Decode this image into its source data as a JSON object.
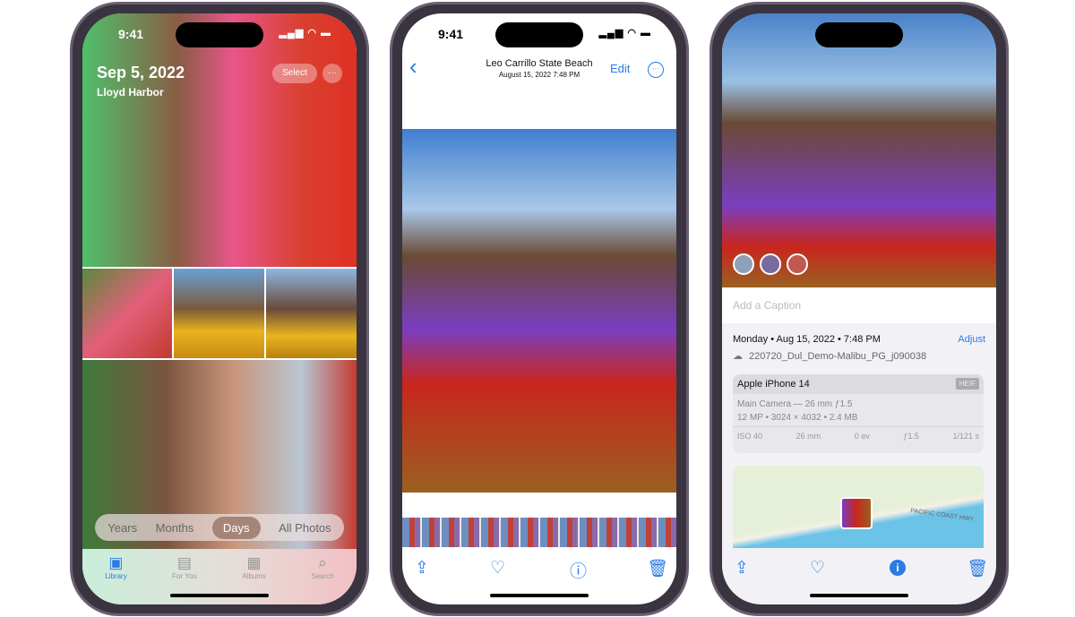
{
  "status_time": "9:41",
  "phone1": {
    "date": "Sep 5, 2022",
    "location": "Lloyd Harbor",
    "select_label": "Select",
    "more_label": "···",
    "segments": [
      {
        "label": "Years"
      },
      {
        "label": "Months"
      },
      {
        "label": "Days",
        "selected": true
      },
      {
        "label": "All Photos"
      }
    ],
    "tabs": [
      {
        "label": "Library",
        "active": true
      },
      {
        "label": "For You"
      },
      {
        "label": "Albums"
      },
      {
        "label": "Search"
      }
    ]
  },
  "phone2": {
    "title": "Leo Carrillo State Beach",
    "subtitle": "August 15, 2022  7:48 PM",
    "edit_label": "Edit",
    "back": "‹",
    "more": "···"
  },
  "phone3": {
    "caption_placeholder": "Add a Caption",
    "datetime": "Monday • Aug 15, 2022 • 7:48 PM",
    "adjust_label": "Adjust",
    "filename": "220720_Dul_Demo-Malibu_PG_j090038",
    "device": "Apple iPhone 14",
    "format": "HEIF",
    "lens": "Main Camera — 26 mm ƒ1.5",
    "specs": "12 MP • 3024 × 4032 • 2.4 MB",
    "exif": [
      "ISO 40",
      "26 mm",
      "0 ev",
      "ƒ1.5",
      "1/121 s"
    ],
    "map_label": "PACIFIC COAST HWY"
  },
  "colors": {
    "accent": "#2a7be4",
    "frame": "#3a3440"
  }
}
